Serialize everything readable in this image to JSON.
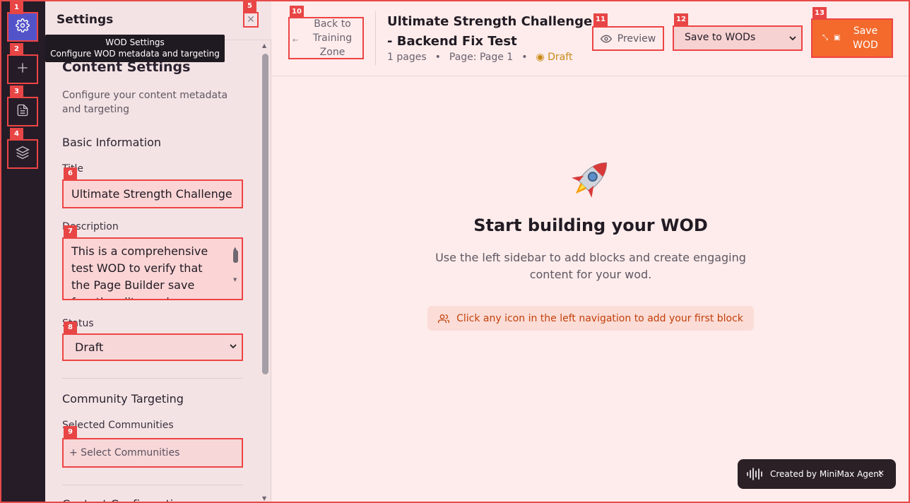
{
  "rail": {
    "items": [
      {
        "num": "1",
        "icon": "gear-icon"
      },
      {
        "num": "2",
        "icon": "plus-icon"
      },
      {
        "num": "3",
        "icon": "document-icon"
      },
      {
        "num": "4",
        "icon": "layers-icon"
      }
    ]
  },
  "panel": {
    "title": "Settings",
    "close_num": "5",
    "close_glyph": "✕",
    "tooltip": {
      "title": "WOD Settings",
      "subtitle": "Configure WOD metadata and targeting"
    },
    "content_title": "Content Settings",
    "content_desc": "Configure your content metadata and targeting",
    "basic_info": "Basic Information",
    "title_label": "Title",
    "title_value": "Ultimate Strength Challenge",
    "title_num": "6",
    "description_label": "Description",
    "description_value": "This is a comprehensive test WOD to verify that the Page Builder save functionality works",
    "description_num": "7",
    "status_label": "Status",
    "status_value": "Draft",
    "status_num": "8",
    "community_title": "Community Targeting",
    "selected_communities_label": "Selected Communities",
    "select_communities": "+ Select Communities",
    "communities_num": "9",
    "next_section": "Content Configuration"
  },
  "header": {
    "back_label": "Back to Training Zone",
    "back_num": "10",
    "title": "Ultimate Strength Challenge - Backend Fix Test",
    "pages": "1 pages",
    "page": "Page: Page 1",
    "status": "Draft",
    "preview_label": "Preview",
    "preview_num": "11",
    "save_target": "Save to WODs",
    "save_target_num": "12",
    "save_label": "Save WOD",
    "save_num": "13"
  },
  "main": {
    "title": "Start building your WOD",
    "description": "Use the left sidebar to add blocks and create engaging content for your wod.",
    "hint": "Click any icon in the left navigation to add your first block"
  },
  "toast": {
    "label": "Created by MiniMax Agent",
    "close": "✕"
  },
  "colors": {
    "accent": "#5353c9",
    "save": "#f36a2c",
    "highlight": "#ee4444",
    "draft": "#c98a16"
  }
}
